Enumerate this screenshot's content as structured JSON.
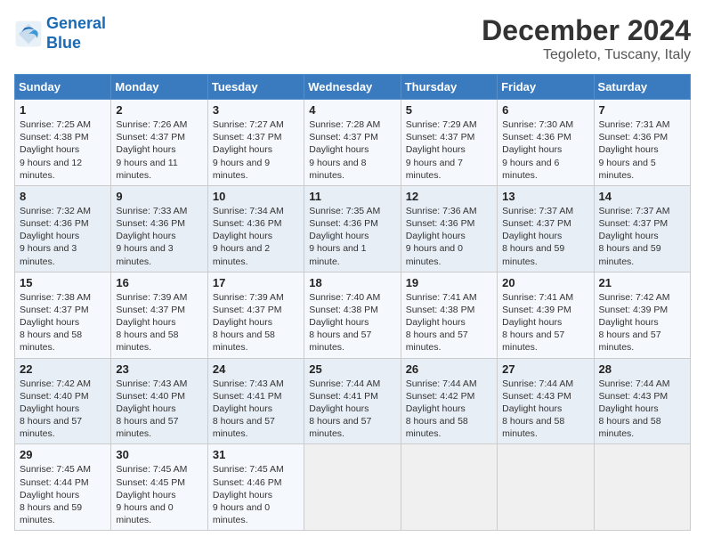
{
  "header": {
    "logo_line1": "General",
    "logo_line2": "Blue",
    "month": "December 2024",
    "location": "Tegoleto, Tuscany, Italy"
  },
  "weekdays": [
    "Sunday",
    "Monday",
    "Tuesday",
    "Wednesday",
    "Thursday",
    "Friday",
    "Saturday"
  ],
  "weeks": [
    [
      {
        "day": "1",
        "sunrise": "7:25 AM",
        "sunset": "4:38 PM",
        "daylight": "9 hours and 12 minutes."
      },
      {
        "day": "2",
        "sunrise": "7:26 AM",
        "sunset": "4:37 PM",
        "daylight": "9 hours and 11 minutes."
      },
      {
        "day": "3",
        "sunrise": "7:27 AM",
        "sunset": "4:37 PM",
        "daylight": "9 hours and 9 minutes."
      },
      {
        "day": "4",
        "sunrise": "7:28 AM",
        "sunset": "4:37 PM",
        "daylight": "9 hours and 8 minutes."
      },
      {
        "day": "5",
        "sunrise": "7:29 AM",
        "sunset": "4:37 PM",
        "daylight": "9 hours and 7 minutes."
      },
      {
        "day": "6",
        "sunrise": "7:30 AM",
        "sunset": "4:36 PM",
        "daylight": "9 hours and 6 minutes."
      },
      {
        "day": "7",
        "sunrise": "7:31 AM",
        "sunset": "4:36 PM",
        "daylight": "9 hours and 5 minutes."
      }
    ],
    [
      {
        "day": "8",
        "sunrise": "7:32 AM",
        "sunset": "4:36 PM",
        "daylight": "9 hours and 3 minutes."
      },
      {
        "day": "9",
        "sunrise": "7:33 AM",
        "sunset": "4:36 PM",
        "daylight": "9 hours and 3 minutes."
      },
      {
        "day": "10",
        "sunrise": "7:34 AM",
        "sunset": "4:36 PM",
        "daylight": "9 hours and 2 minutes."
      },
      {
        "day": "11",
        "sunrise": "7:35 AM",
        "sunset": "4:36 PM",
        "daylight": "9 hours and 1 minute."
      },
      {
        "day": "12",
        "sunrise": "7:36 AM",
        "sunset": "4:36 PM",
        "daylight": "9 hours and 0 minutes."
      },
      {
        "day": "13",
        "sunrise": "7:37 AM",
        "sunset": "4:37 PM",
        "daylight": "8 hours and 59 minutes."
      },
      {
        "day": "14",
        "sunrise": "7:37 AM",
        "sunset": "4:37 PM",
        "daylight": "8 hours and 59 minutes."
      }
    ],
    [
      {
        "day": "15",
        "sunrise": "7:38 AM",
        "sunset": "4:37 PM",
        "daylight": "8 hours and 58 minutes."
      },
      {
        "day": "16",
        "sunrise": "7:39 AM",
        "sunset": "4:37 PM",
        "daylight": "8 hours and 58 minutes."
      },
      {
        "day": "17",
        "sunrise": "7:39 AM",
        "sunset": "4:37 PM",
        "daylight": "8 hours and 58 minutes."
      },
      {
        "day": "18",
        "sunrise": "7:40 AM",
        "sunset": "4:38 PM",
        "daylight": "8 hours and 57 minutes."
      },
      {
        "day": "19",
        "sunrise": "7:41 AM",
        "sunset": "4:38 PM",
        "daylight": "8 hours and 57 minutes."
      },
      {
        "day": "20",
        "sunrise": "7:41 AM",
        "sunset": "4:39 PM",
        "daylight": "8 hours and 57 minutes."
      },
      {
        "day": "21",
        "sunrise": "7:42 AM",
        "sunset": "4:39 PM",
        "daylight": "8 hours and 57 minutes."
      }
    ],
    [
      {
        "day": "22",
        "sunrise": "7:42 AM",
        "sunset": "4:40 PM",
        "daylight": "8 hours and 57 minutes."
      },
      {
        "day": "23",
        "sunrise": "7:43 AM",
        "sunset": "4:40 PM",
        "daylight": "8 hours and 57 minutes."
      },
      {
        "day": "24",
        "sunrise": "7:43 AM",
        "sunset": "4:41 PM",
        "daylight": "8 hours and 57 minutes."
      },
      {
        "day": "25",
        "sunrise": "7:44 AM",
        "sunset": "4:41 PM",
        "daylight": "8 hours and 57 minutes."
      },
      {
        "day": "26",
        "sunrise": "7:44 AM",
        "sunset": "4:42 PM",
        "daylight": "8 hours and 58 minutes."
      },
      {
        "day": "27",
        "sunrise": "7:44 AM",
        "sunset": "4:43 PM",
        "daylight": "8 hours and 58 minutes."
      },
      {
        "day": "28",
        "sunrise": "7:44 AM",
        "sunset": "4:43 PM",
        "daylight": "8 hours and 58 minutes."
      }
    ],
    [
      {
        "day": "29",
        "sunrise": "7:45 AM",
        "sunset": "4:44 PM",
        "daylight": "8 hours and 59 minutes."
      },
      {
        "day": "30",
        "sunrise": "7:45 AM",
        "sunset": "4:45 PM",
        "daylight": "9 hours and 0 minutes."
      },
      {
        "day": "31",
        "sunrise": "7:45 AM",
        "sunset": "4:46 PM",
        "daylight": "9 hours and 0 minutes."
      },
      null,
      null,
      null,
      null
    ]
  ],
  "labels": {
    "sunrise": "Sunrise:",
    "sunset": "Sunset:",
    "daylight": "Daylight hours"
  }
}
